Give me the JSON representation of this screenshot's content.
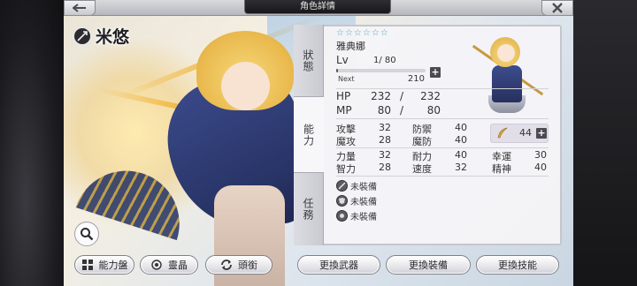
{
  "header": {
    "title": "角色詳情",
    "back_icon": "back-arrow-icon",
    "close_icon": "close-x-icon"
  },
  "character": {
    "display_name": "米悠",
    "class_icon": "spear-class-icon",
    "name": "雅典娜",
    "rarity_stars": "☆☆☆☆☆☆",
    "level_label": "Lv",
    "level": "1/ 80",
    "level_progress": 0.02,
    "next_label": "Next",
    "next_exp": "210"
  },
  "side_tabs": [
    {
      "label": "狀態"
    },
    {
      "label": "能力"
    },
    {
      "label": "任務"
    }
  ],
  "active_tab_index": 1,
  "hp_mp": {
    "hp_label": "HP",
    "hp_current": "232",
    "hp_sep": "/",
    "hp_max": "232",
    "mp_label": "MP",
    "mp_current": "80",
    "mp_sep": "/",
    "mp_max": "80"
  },
  "stats": {
    "rows": [
      [
        {
          "label": "攻擊",
          "value": "32"
        },
        {
          "label": "防禦",
          "value": "40"
        }
      ],
      [
        {
          "label": "魔攻",
          "value": "28"
        },
        {
          "label": "魔防",
          "value": "40"
        }
      ],
      [
        {
          "label": "力量",
          "value": "32"
        },
        {
          "label": "耐力",
          "value": "40"
        },
        {
          "label": "幸運",
          "value": "30"
        }
      ],
      [
        {
          "label": "智力",
          "value": "28"
        },
        {
          "label": "速度",
          "value": "32"
        },
        {
          "label": "精神",
          "value": "40"
        }
      ]
    ],
    "feather_points": "44",
    "feather_icon": "feather-icon"
  },
  "equipment": [
    {
      "icon": "weapon-slot-icon",
      "label": "未裝備"
    },
    {
      "icon": "armor-slot-icon",
      "label": "未裝備"
    },
    {
      "icon": "skill-slot-icon",
      "label": "未裝備"
    }
  ],
  "bottom_buttons": {
    "ability_board": "能力盤",
    "spirit": "靈晶",
    "title": "頭銜",
    "change_weapon": "更換武器",
    "change_gear": "更換裝備",
    "change_skill": "更換技能"
  },
  "colors": {
    "accent_star": "#46a6c9",
    "panel_bg": "#f5f4f7",
    "dark_text": "#333333"
  }
}
